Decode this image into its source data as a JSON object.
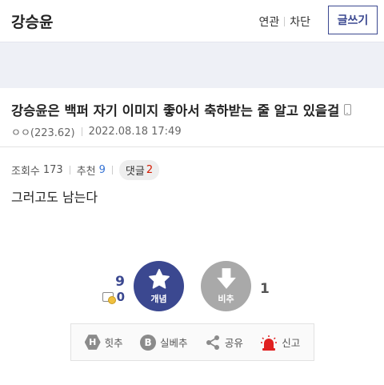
{
  "header": {
    "gallery_title": "강승윤",
    "link_related": "연관",
    "link_block": "차단",
    "write_button": "글쓰기"
  },
  "post": {
    "title": "강승윤은 백퍼 자기 이미지 좋아서 축하받는 줄 알고 있을걸",
    "author": "ㅇㅇ(223.62)",
    "date": "2022.08.18 17:49",
    "views_label": "조회수",
    "views": "173",
    "recommend_label": "추천",
    "recommend": "9",
    "comments_label": "댓글",
    "comments": "2",
    "body": "그러고도 남는다"
  },
  "recommend": {
    "up_count": "9",
    "fix_count": "0",
    "up_label": "개념",
    "down_label": "비추",
    "down_count": "1"
  },
  "actions": {
    "hit": "힛추",
    "best": "실베추",
    "share": "공유",
    "report": "신고"
  },
  "colors": {
    "accent": "#3b4890",
    "down_button": "#a9a9a9",
    "comment_count": "#d31900",
    "recommend_count": "#3673d4",
    "report_icon": "#e02020"
  }
}
